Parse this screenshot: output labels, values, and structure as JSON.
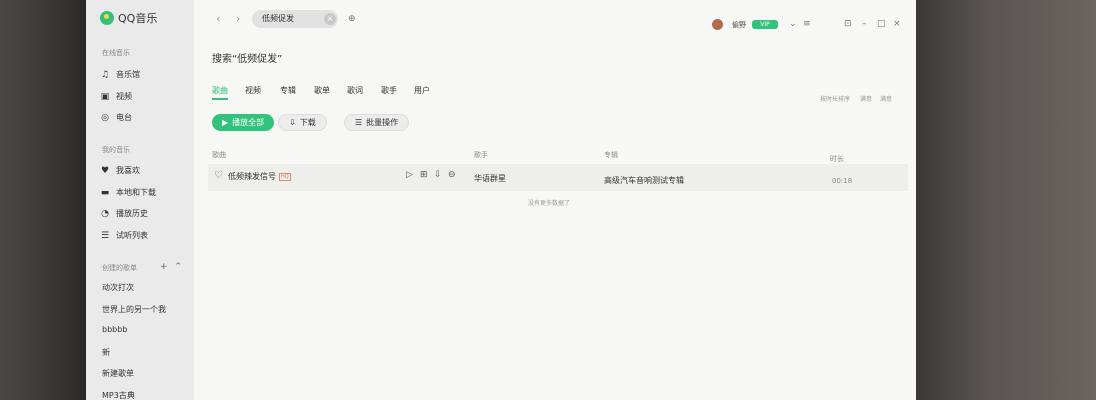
{
  "app": {
    "name": "QQ音乐"
  },
  "sidebar": {
    "online_title": "在线音乐",
    "online_items": [
      {
        "label": "音乐馆",
        "icon": "music-note-icon"
      },
      {
        "label": "视频",
        "icon": "video-icon"
      },
      {
        "label": "电台",
        "icon": "radio-icon"
      }
    ],
    "my_title": "我的音乐",
    "my_items": [
      {
        "label": "我喜欢",
        "icon": "heart-icon"
      },
      {
        "label": "本地和下载",
        "icon": "computer-icon"
      },
      {
        "label": "播放历史",
        "icon": "clock-icon"
      },
      {
        "label": "试听列表",
        "icon": "list-icon"
      }
    ],
    "created_title": "创建的歌单",
    "created_items": [
      {
        "label": "动次打次"
      },
      {
        "label": "世界上的另一个我"
      },
      {
        "label": "bbbbb"
      },
      {
        "label": "新"
      },
      {
        "label": "新建歌单"
      },
      {
        "label": "MP3古典"
      }
    ]
  },
  "topbar": {
    "search_value": "低频促发",
    "username": "偷野",
    "vip_label": "VIP"
  },
  "search": {
    "prefix": "搜索",
    "query": "“低频促发”"
  },
  "tabs": [
    "歌曲",
    "视频",
    "专辑",
    "歌单",
    "歌词",
    "歌手",
    "用户"
  ],
  "sort": {
    "label": "按时长排序",
    "option1": "满意",
    "option2": "满意"
  },
  "actions": {
    "play_all": "播放全部",
    "download": "下载",
    "batch": "批量操作"
  },
  "table": {
    "headers": {
      "song": "歌曲",
      "artist": "歌手",
      "album": "专辑",
      "duration": "时长"
    },
    "rows": [
      {
        "song": "低频辣发信号",
        "tag": "HQ",
        "artist": "华语群星",
        "album": "高级汽车音响测试专辑",
        "duration": "00:18"
      }
    ],
    "footer": "没有更多数据了"
  },
  "colors": {
    "accent": "#31c27c"
  }
}
